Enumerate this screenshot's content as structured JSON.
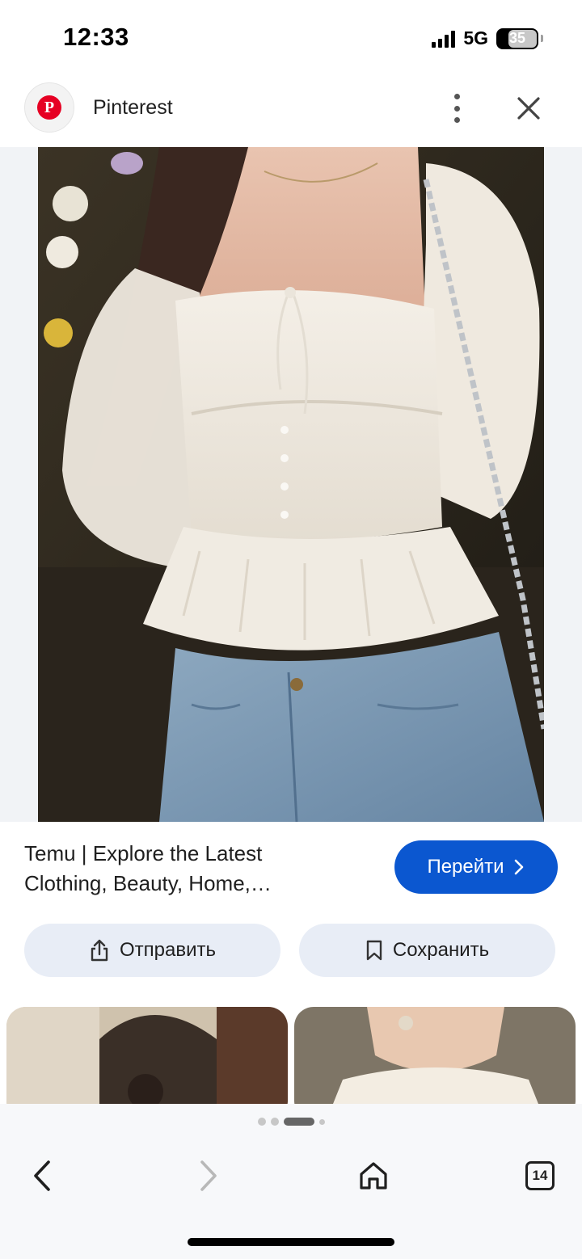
{
  "status_bar": {
    "time": "12:33",
    "network": "5G",
    "battery": "35"
  },
  "header": {
    "app_name": "Pinterest",
    "logo_letter": "P",
    "more_icon": "more-vert-icon",
    "close_icon": "close-icon"
  },
  "result": {
    "caption_line1": "Temu | Explore the Latest",
    "caption_line2": "Clothing, Beauty, Home,…",
    "visit_label": "Перейти",
    "share_label": "Отправить",
    "save_label": "Сохранить"
  },
  "pager": {
    "count": 4,
    "active_index": 2
  },
  "nav": {
    "tabs_count": "14"
  },
  "colors": {
    "accent": "#0b57d0",
    "chip_bg": "#e8edf6",
    "pinterest_red": "#e60023"
  }
}
